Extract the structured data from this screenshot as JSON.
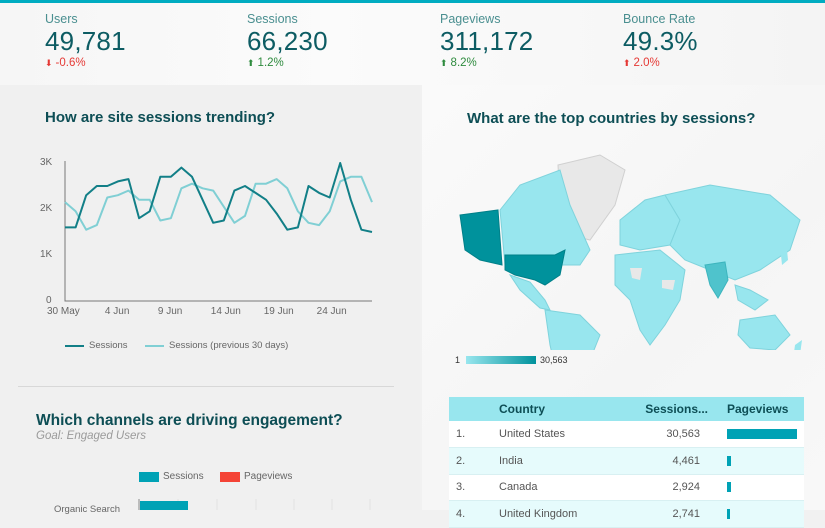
{
  "kpis": [
    {
      "label": "Users",
      "value": "49,781",
      "change": "-0.6%",
      "direction": "down",
      "sentiment": "bad"
    },
    {
      "label": "Sessions",
      "value": "66,230",
      "change": "1.2%",
      "direction": "up",
      "sentiment": "good"
    },
    {
      "label": "Pageviews",
      "value": "311,172",
      "change": "8.2%",
      "direction": "up",
      "sentiment": "good"
    },
    {
      "label": "Bounce Rate",
      "value": "49.3%",
      "change": "2.0%",
      "direction": "up",
      "sentiment": "bad"
    }
  ],
  "icons": {
    "down": "down-arrow-icon",
    "up": "up-arrow-icon"
  },
  "colors": {
    "accent": "#00acc1",
    "sessions": "#127f87",
    "sessions_prev": "#80cfd4",
    "bar_sessions": "#00a2b5",
    "bar_pageviews": "#f44336",
    "map_high": "#00929c",
    "map_low": "#98e6ee"
  },
  "trend": {
    "title": "How are site sessions trending?",
    "chart_data": {
      "type": "line",
      "title": "How are site sessions trending?",
      "xlabel": "",
      "ylabel": "",
      "ylim": [
        0,
        3000
      ],
      "yticks": [
        "0",
        "1K",
        "2K",
        "3K"
      ],
      "xticks": [
        "30 May",
        "4 Jun",
        "9 Jun",
        "14 Jun",
        "19 Jun",
        "24 Jun"
      ],
      "grid": false,
      "legend": "bottom",
      "series": [
        {
          "name": "Sessions",
          "values": [
            1600,
            1600,
            2300,
            2500,
            2500,
            2600,
            2650,
            1800,
            1950,
            2700,
            2700,
            2900,
            2700,
            2200,
            1700,
            1750,
            2400,
            2500,
            2350,
            2200,
            1900,
            1550,
            1600,
            2500,
            2350,
            2250,
            3000,
            2200,
            1550,
            1500
          ]
        },
        {
          "name": "Sessions (previous 30 days)",
          "values": [
            2150,
            1950,
            1550,
            1650,
            2250,
            2300,
            2400,
            2200,
            2200,
            1750,
            1800,
            2450,
            2550,
            2450,
            2400,
            2050,
            1700,
            1850,
            2550,
            2550,
            2650,
            2450,
            1950,
            1700,
            1650,
            1950,
            2600,
            2700,
            2700,
            2150
          ]
        }
      ]
    }
  },
  "channels": {
    "title": "Which channels are driving engagement?",
    "subtitle": "Goal: Engaged Users",
    "legend": [
      "Sessions",
      "Pageviews"
    ],
    "first_row_label": "Organic Search"
  },
  "countries": {
    "title": "What are the top countries by sessions?",
    "scale_min": "1",
    "scale_max": "30,563",
    "table": {
      "headers": [
        "Country",
        "Sessions...",
        "Pageviews"
      ],
      "rows": [
        {
          "rank": "1.",
          "country": "United States",
          "sessions": "30,563",
          "pageviews_fraction": 1.0
        },
        {
          "rank": "2.",
          "country": "India",
          "sessions": "4,461",
          "pageviews_fraction": 0.05
        },
        {
          "rank": "3.",
          "country": "Canada",
          "sessions": "2,924",
          "pageviews_fraction": 0.06
        },
        {
          "rank": "4.",
          "country": "United Kingdom",
          "sessions": "2,741",
          "pageviews_fraction": 0.03
        }
      ]
    }
  }
}
